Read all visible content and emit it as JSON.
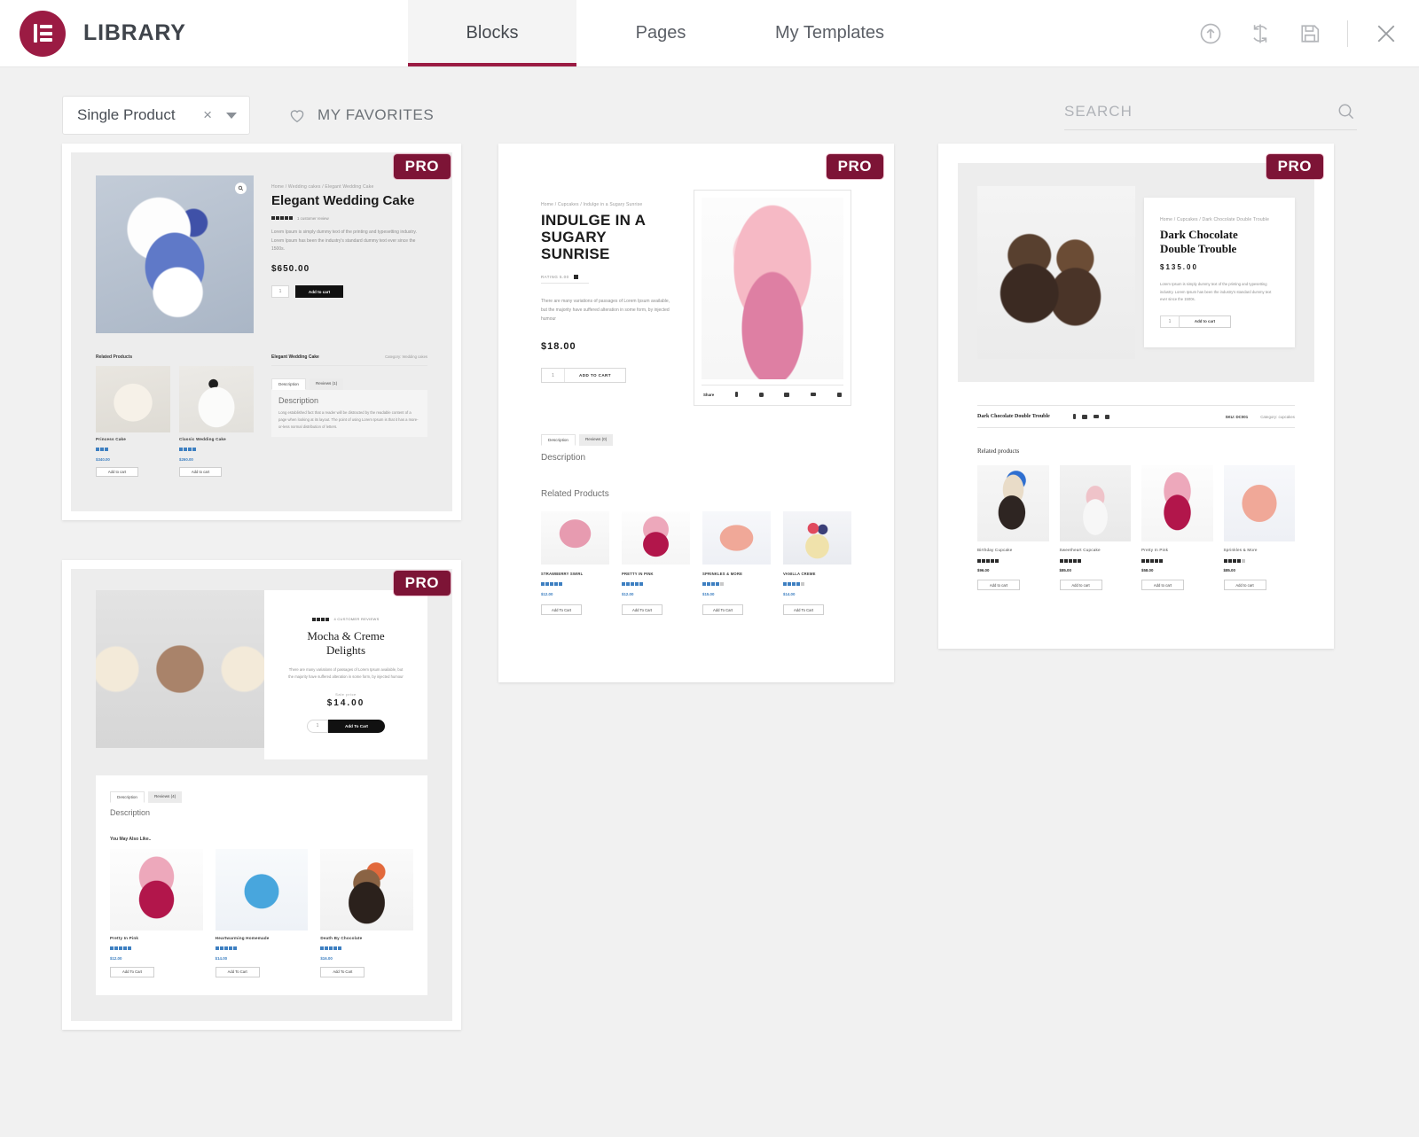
{
  "header": {
    "brand": "LIBRARY",
    "logo_color": "#9b1b43",
    "tabs": [
      {
        "label": "Blocks",
        "active": true
      },
      {
        "label": "Pages",
        "active": false
      },
      {
        "label": "My Templates",
        "active": false
      }
    ],
    "actions": [
      {
        "name": "upload-icon",
        "title": "Import Template"
      },
      {
        "name": "sync-icon",
        "title": "Sync Library"
      },
      {
        "name": "save-icon",
        "title": "Save"
      },
      {
        "name": "close-icon",
        "title": "Close"
      }
    ]
  },
  "toolbar": {
    "filter_value": "Single Product",
    "filter_clear": "×",
    "favorites_label": "MY FAVORITES",
    "search_placeholder": "SEARCH",
    "search_value": ""
  },
  "badge": {
    "pro": "PRO"
  },
  "cards": [
    {
      "id": "elegant-wedding-cake",
      "breadcrumb": "Home / Wedding cakes / Elegant Wedding Cake",
      "title": "Elegant Wedding Cake",
      "rating_text": "1 customer review",
      "description": "Lorem Ipsum is simply dummy text of the printing and typesetting industry. Lorem Ipsum has been the industry's standard dummy text ever since the 1500s.",
      "price": "$650.00",
      "qty": "1",
      "add_to_cart": "Add to cart",
      "meta_title": "Elegant Wedding Cake",
      "meta_category": "Category: Wedding cakes",
      "tabs": [
        "Description",
        "Reviews (1)"
      ],
      "section_title": "Description",
      "section_body": "Long established fact that a reader will be distracted by the readable content of a page when looking at its layout. The point of using Lorem Ipsum is that it has a more-or-less normal distribution of letters.",
      "related_label": "Related Products",
      "related": [
        {
          "name": "Princess Cake",
          "price": "$340.00",
          "stars": 3,
          "button": "Add to cart"
        },
        {
          "name": "Classic Wedding Cake",
          "price": "$260.00",
          "stars": 4,
          "button": "Add to cart"
        }
      ]
    },
    {
      "id": "sugary-sunrise",
      "breadcrumb": "Home / Cupcakes / Indulge in a Sugary Sunrise",
      "title_line1": "INDULGE IN A",
      "title_line2": "SUGARY SUNRISE",
      "rating_text": "RATING  5.00",
      "description": "There are many variations of passages of Lorem Ipsum available, but the majority have suffered alteration in some form, by injected humour",
      "price": "$18.00",
      "qty": "1",
      "add_to_cart": "ADD TO CART",
      "share_label": "Share",
      "tabs": [
        "Description",
        "Reviews (0)"
      ],
      "section_title": "Description",
      "related_label": "Related Products",
      "related": [
        {
          "name": "STRAWBERRY SWIRL",
          "price": "$12.00",
          "stars": 5,
          "button": "Add To Cart"
        },
        {
          "name": "PRETTY IN PINK",
          "price": "$12.00",
          "stars": 5,
          "button": "Add To Cart"
        },
        {
          "name": "SPRINKLES & MORE",
          "price": "$15.00",
          "stars": 4,
          "button": "Add To Cart"
        },
        {
          "name": "VANILLA CREME",
          "price": "$14.00",
          "stars": 4,
          "button": "Add To Cart"
        }
      ]
    },
    {
      "id": "dark-chocolate-double-trouble",
      "breadcrumb": "Home / Cupcakes / Dark Chocolate Double Trouble",
      "title_line1": "Dark Chocolate",
      "title_line2": "Double Trouble",
      "price": "$135.00",
      "description": "Lorem Ipsum is simply dummy text of the printing and typesetting industry. Lorem Ipsum has been the industry's standard dummy text ever since the 1500s.",
      "qty": "1",
      "add_to_cart": "Add to cart",
      "meta_title": "Dark Chocolate Double Trouble",
      "meta_sku": "SKU: DC001",
      "meta_category": "Category: cupcakes",
      "related_label": "Related products",
      "related": [
        {
          "name": "Birthday Cupcake",
          "price": "$96.00",
          "stars": 5,
          "button": "Add to cart"
        },
        {
          "name": "Sweetheart Cupcake",
          "price": "$85.00",
          "stars": 5,
          "button": "Add to cart"
        },
        {
          "name": "Pretty In Pink",
          "price": "$58.00",
          "stars": 5,
          "button": "Add to cart"
        },
        {
          "name": "Sprinkles & More",
          "price": "$85.00",
          "stars": 4,
          "button": "Add to cart"
        }
      ]
    },
    {
      "id": "mocha-creme-delights",
      "rating_text": "4 CUSTOMER REVIEWS",
      "title_line1": "Mocha & Creme",
      "title_line2": "Delights",
      "description": "There are many variations of passages of Lorem Ipsum available, but the majority have suffered alteration in some form, by injected humour",
      "price_label": "Sale price",
      "price": "$14.00",
      "qty": "1",
      "add_to_cart": "Add To Cart",
      "tabs": [
        "Description",
        "Reviews (4)"
      ],
      "section_title": "Description",
      "related_label": "You May Also Like..",
      "related": [
        {
          "name": "Pretty In Pink",
          "price": "$12.00",
          "stars": 5,
          "button": "Add To Cart"
        },
        {
          "name": "Heartwarming Homemade",
          "price": "$14.00",
          "stars": 5,
          "button": "Add To Cart"
        },
        {
          "name": "Death By Chocolate",
          "price": "$16.00",
          "stars": 5,
          "button": "Add To Cart"
        }
      ]
    }
  ]
}
